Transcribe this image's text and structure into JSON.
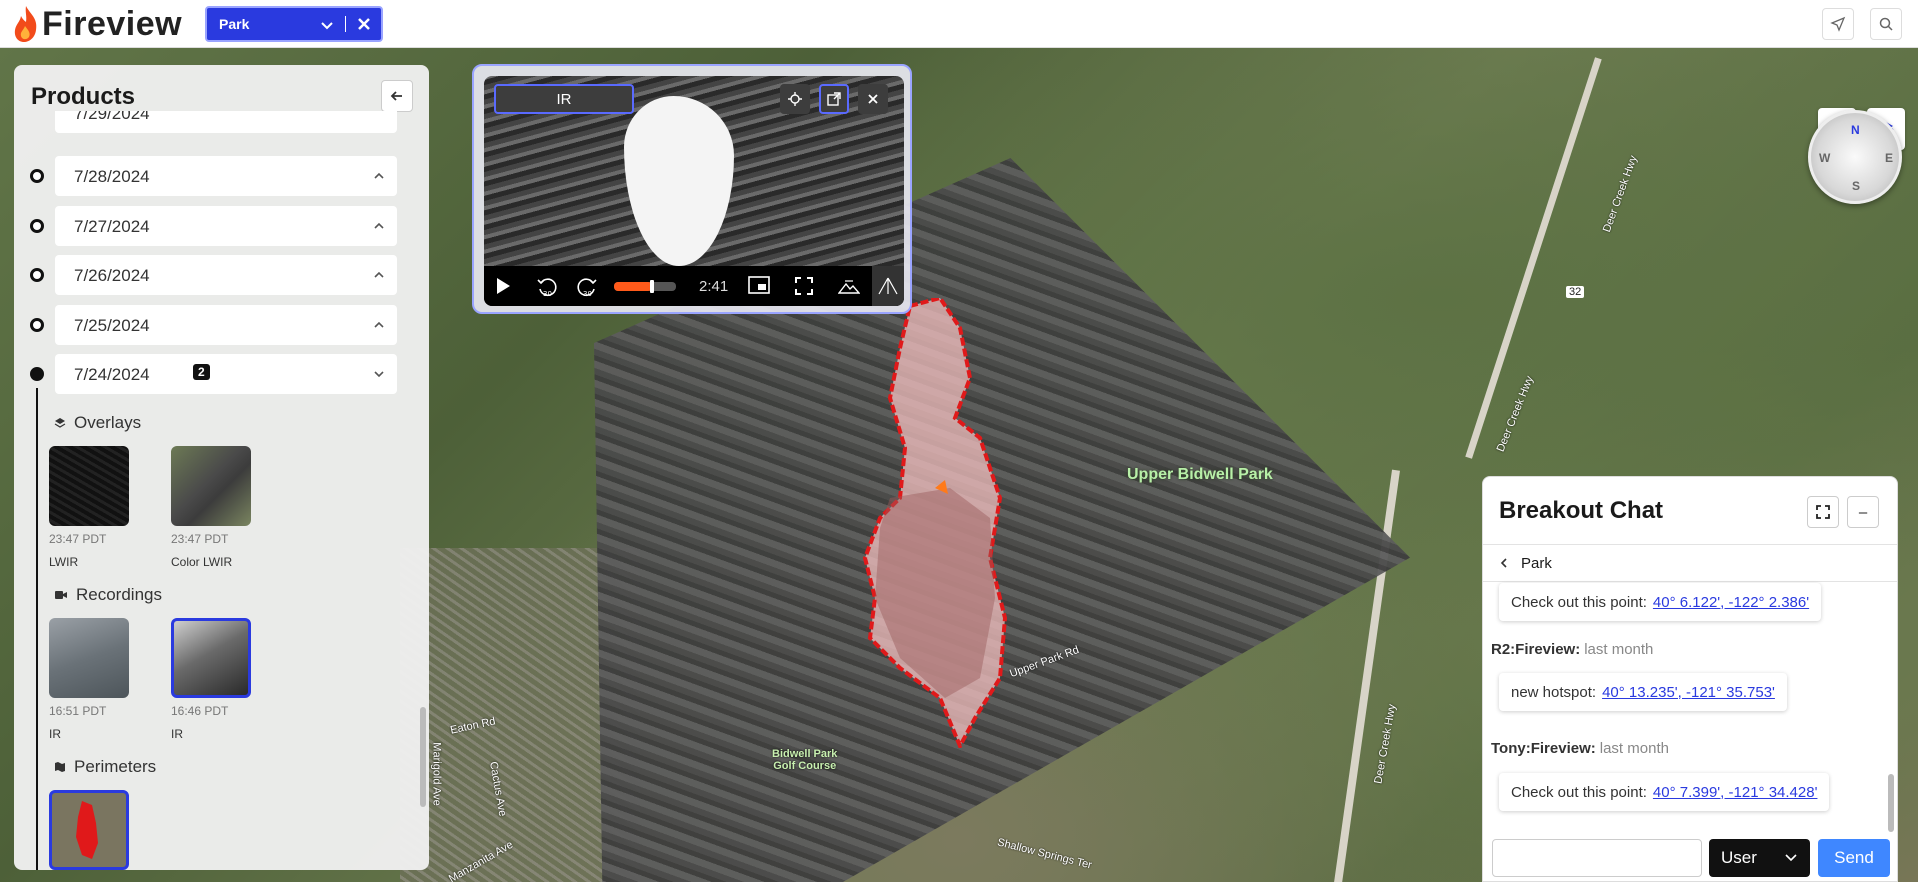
{
  "app": {
    "title": "Fireview",
    "accent": "#2a3adf"
  },
  "header": {
    "fire_select": {
      "value": "Park",
      "icons": [
        "chevron-down-icon",
        "close-icon"
      ]
    },
    "right_icons": [
      "locate-arrow-icon",
      "search-icon"
    ]
  },
  "map": {
    "labels": {
      "upper_bidwell": "Upper Bidwell Park",
      "upper_park_rd": "Upper Park Rd",
      "golf_course": "Bidwell Park\nGolf Course",
      "eaton_rd": "Eaton Rd",
      "shallow_springs": "Shallow Springs Ter",
      "manzanita": "Manzanita Ave",
      "cactus": "Cactus Ave",
      "marigold": "Marigold Ave",
      "deer_creek_1": "Deer Creek Hwy",
      "deer_creek_2": "Deer Creek Hwy",
      "deer_creek_3": "Deer Creek Hwy",
      "route": "32"
    },
    "tools": [
      "pencil-icon",
      "layers-icon"
    ],
    "compass": {
      "n": "N",
      "s": "S",
      "e": "E",
      "w": "W"
    },
    "colors": {
      "perimeter": "#e0191a",
      "burned": "#f4c0c0"
    }
  },
  "products": {
    "title": "Products",
    "collapse_icon": "arrow-left-icon",
    "dates": [
      {
        "label": "7/29/2024",
        "expanded": false
      },
      {
        "label": "7/28/2024",
        "expanded": false
      },
      {
        "label": "7/27/2024",
        "expanded": false
      },
      {
        "label": "7/26/2024",
        "expanded": false
      },
      {
        "label": "7/25/2024",
        "expanded": false
      },
      {
        "label": "7/24/2024",
        "expanded": true,
        "badge": "2"
      }
    ],
    "sections": {
      "overlays": {
        "title": "Overlays",
        "items": [
          {
            "time": "23:47 PDT",
            "name": "LWIR"
          },
          {
            "time": "23:47 PDT",
            "name": "Color LWIR"
          }
        ]
      },
      "recordings": {
        "title": "Recordings",
        "items": [
          {
            "time": "16:51 PDT",
            "name": "IR",
            "selected": false
          },
          {
            "time": "16:46 PDT",
            "name": "IR",
            "selected": true
          }
        ]
      },
      "perimeters": {
        "title": "Perimeters"
      }
    }
  },
  "video": {
    "chip": "IR",
    "top_icons": [
      "crosshair-icon",
      "external-link-icon",
      "close-icon"
    ],
    "controls": [
      "play-icon",
      "rewind-30-icon",
      "forward-30-icon",
      "pip-icon",
      "fullscreen-icon",
      "terrain-icon",
      "measure-icon"
    ],
    "skip_back": "30",
    "skip_fwd": "30",
    "time": "2:41",
    "progress": 0.62
  },
  "chat": {
    "title": "Breakout Chat",
    "header_icons": [
      "expand-icon",
      "minimize-icon"
    ],
    "minimize_label": "–",
    "channel": "Park",
    "messages": [
      {
        "author": "",
        "when": "",
        "text": "Check out this point:",
        "link": "40° 6.122', -122° 2.386'"
      },
      {
        "author": "R2:Fireview:",
        "when": "last month",
        "text": "new hotspot:",
        "link": "40° 13.235', -121° 35.753'"
      },
      {
        "author": "Tony:Fireview:",
        "when": "last month",
        "text": "Check out this point:",
        "link": "40° 7.399', -121° 34.428'"
      }
    ],
    "input": {
      "value": "",
      "placeholder": ""
    },
    "role": "User",
    "send": "Send"
  }
}
